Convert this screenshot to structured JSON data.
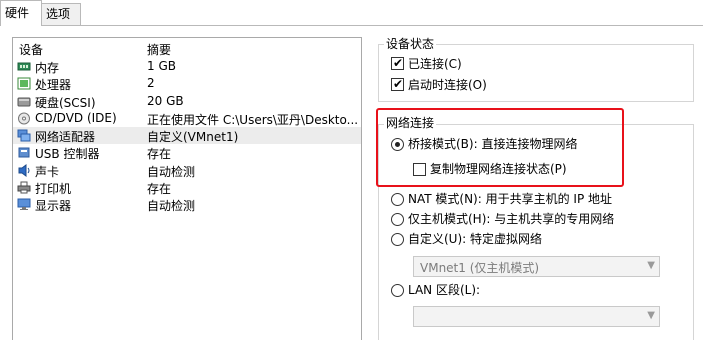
{
  "tabs": [
    "硬件",
    "选项"
  ],
  "device_list": {
    "header": {
      "device": "设备",
      "summary": "摘要"
    },
    "rows": [
      {
        "name": "内存",
        "summary": "1 GB",
        "icon": "memory-icon"
      },
      {
        "name": "处理器",
        "summary": "2",
        "icon": "processor-icon"
      },
      {
        "name": "硬盘(SCSI)",
        "summary": "20 GB",
        "icon": "hard-disk-icon"
      },
      {
        "name": "CD/DVD (IDE)",
        "summary": "正在使用文件 C:\\Users\\亚丹\\Deskto...",
        "icon": "cd-dvd-icon"
      },
      {
        "name": "网络适配器",
        "summary": "自定义(VMnet1)",
        "icon": "network-adapter-icon",
        "selected": true
      },
      {
        "name": "USB 控制器",
        "summary": "存在",
        "icon": "usb-icon"
      },
      {
        "name": "声卡",
        "summary": "自动检测",
        "icon": "sound-card-icon"
      },
      {
        "name": "打印机",
        "summary": "存在",
        "icon": "printer-icon"
      },
      {
        "name": "显示器",
        "summary": "自动检测",
        "icon": "display-icon"
      }
    ]
  },
  "device_status": {
    "title": "设备状态",
    "connected": {
      "label": "已连接(C)",
      "checked": true
    },
    "connect_at_power_on": {
      "label": "启动时连接(O)",
      "checked": true
    }
  },
  "network": {
    "title": "网络连接",
    "bridged": {
      "label": "桥接模式(B): 直接连接物理网络",
      "selected": true
    },
    "replicate": {
      "label": "复制物理网络连接状态(P)",
      "checked": false
    },
    "nat": {
      "label": "NAT 模式(N): 用于共享主机的 IP 地址",
      "selected": false
    },
    "host_only": {
      "label": "仅主机模式(H): 与主机共享的专用网络",
      "selected": false
    },
    "custom": {
      "label": "自定义(U): 特定虚拟网络",
      "selected": false
    },
    "custom_select": "VMnet1 (仅主机模式)",
    "lan": {
      "label": "LAN 区段(L):",
      "selected": false
    },
    "lan_select": ""
  },
  "colors": {
    "highlight": "#e8111a",
    "selected_row": "#ececec"
  }
}
